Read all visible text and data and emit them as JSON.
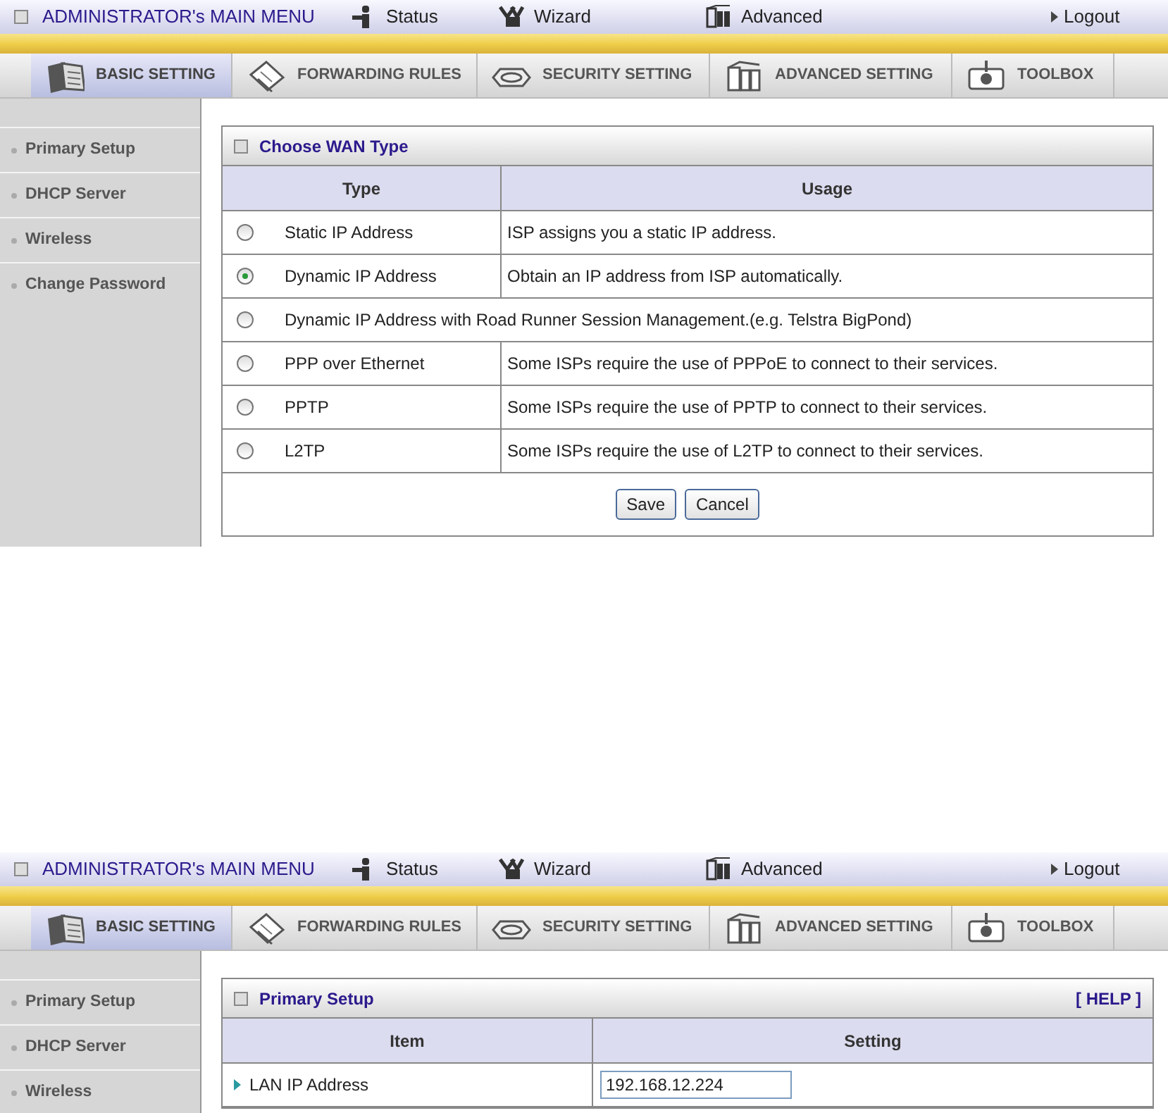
{
  "screens": [
    {
      "header": {
        "title": "ADMINISTRATOR's MAIN MENU",
        "menu": [
          {
            "label": "Status",
            "kind": "status"
          },
          {
            "label": "Wizard",
            "kind": "wizard"
          },
          {
            "label": "Advanced",
            "kind": "advanced"
          }
        ],
        "logout": "Logout"
      },
      "tabs": [
        {
          "label": "BASIC SETTING",
          "kind": "basic",
          "selected": true
        },
        {
          "label": "FORWARDING RULES",
          "kind": "forwarding",
          "selected": false
        },
        {
          "label": "SECURITY SETTING",
          "kind": "security",
          "selected": false
        },
        {
          "label": "ADVANCED SETTING",
          "kind": "advanced",
          "selected": false
        },
        {
          "label": "TOOLBOX",
          "kind": "toolbox",
          "selected": false
        }
      ],
      "sidebar": [
        "Primary Setup",
        "DHCP Server",
        "Wireless",
        "Change Password"
      ],
      "panel": {
        "kind": "choice",
        "title": "Choose WAN Type",
        "columns": [
          "Type",
          "Usage"
        ],
        "rows": [
          {
            "type": "Static IP Address",
            "usage": "ISP assigns you a static IP address.",
            "selected": false
          },
          {
            "type": "Dynamic IP Address",
            "usage": "Obtain an IP address from ISP automatically.",
            "selected": true
          },
          {
            "type": "Dynamic IP Address with Road Runner Session Management.(e.g. Telstra BigPond)",
            "selected": false
          },
          {
            "type": "PPP over Ethernet",
            "usage": "Some ISPs require the use of PPPoE to connect to their services.",
            "selected": false
          },
          {
            "type": "PPTP",
            "usage": "Some ISPs require the use of PPTP to connect to their services.",
            "selected": false
          },
          {
            "type": "L2TP",
            "usage": "Some ISPs require the use of L2TP to connect to their services.",
            "selected": false
          }
        ],
        "buttons": [
          "Save",
          "Cancel"
        ]
      }
    },
    {
      "header": {
        "title": "ADMINISTRATOR's MAIN MENU",
        "menu": [
          {
            "label": "Status",
            "kind": "status"
          },
          {
            "label": "Wizard",
            "kind": "wizard"
          },
          {
            "label": "Advanced",
            "kind": "advanced"
          }
        ],
        "logout": "Logout"
      },
      "tabs": [
        {
          "label": "BASIC SETTING",
          "kind": "basic",
          "selected": true
        },
        {
          "label": "FORWARDING RULES",
          "kind": "forwarding",
          "selected": false
        },
        {
          "label": "SECURITY SETTING",
          "kind": "security",
          "selected": false
        },
        {
          "label": "ADVANCED SETTING",
          "kind": "advanced",
          "selected": false
        },
        {
          "label": "TOOLBOX",
          "kind": "toolbox",
          "selected": false
        }
      ],
      "sidebar": [
        "Primary Setup",
        "DHCP Server",
        "Wireless"
      ],
      "panel": {
        "kind": "settings",
        "title": "Primary Setup",
        "help": "[ HELP ]",
        "columns": [
          "Item",
          "Setting"
        ],
        "rows": [
          {
            "item": "LAN IP Address",
            "value": "192.168.12.224"
          }
        ]
      }
    }
  ]
}
